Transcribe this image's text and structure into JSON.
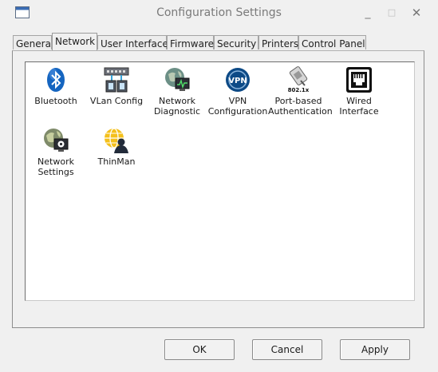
{
  "window": {
    "title": "Configuration Settings",
    "icons": {
      "app": "window-app-icon",
      "minimize": "minimize-icon",
      "maximize": "maximize-icon",
      "close": "close-icon"
    },
    "minimize_glyph": "_",
    "maximize_glyph": "□",
    "close_glyph": "✕"
  },
  "tabs": [
    {
      "label": "General"
    },
    {
      "label": "Network",
      "active": true
    },
    {
      "label": "User Interface"
    },
    {
      "label": "Firmware"
    },
    {
      "label": "Security"
    },
    {
      "label": "Printers"
    },
    {
      "label": "Control Panel"
    }
  ],
  "items": [
    {
      "label": "Bluetooth",
      "icon": "bluetooth-icon"
    },
    {
      "label": "VLan Config",
      "icon": "vlan-config-icon"
    },
    {
      "label": "Network Diagnostic",
      "icon": "network-diagnostic-icon"
    },
    {
      "label": "VPN Configuration",
      "icon": "vpn-icon",
      "icon_text": "VPN"
    },
    {
      "label": "Port-based Authentication",
      "icon": "port-auth-icon",
      "icon_text": "802.1x"
    },
    {
      "label": "Wired Interface",
      "icon": "ethernet-port-icon"
    },
    {
      "label": "Network Settings",
      "icon": "network-settings-icon"
    },
    {
      "label": "ThinMan",
      "icon": "thinman-icon"
    }
  ],
  "buttons": {
    "ok": "OK",
    "cancel": "Cancel",
    "apply": "Apply"
  },
  "colors": {
    "bluetooth": "#1565c0",
    "vpn": "#0d4a86",
    "thinman_globe": "#f4c01b",
    "accent_dark": "#222b3a"
  }
}
